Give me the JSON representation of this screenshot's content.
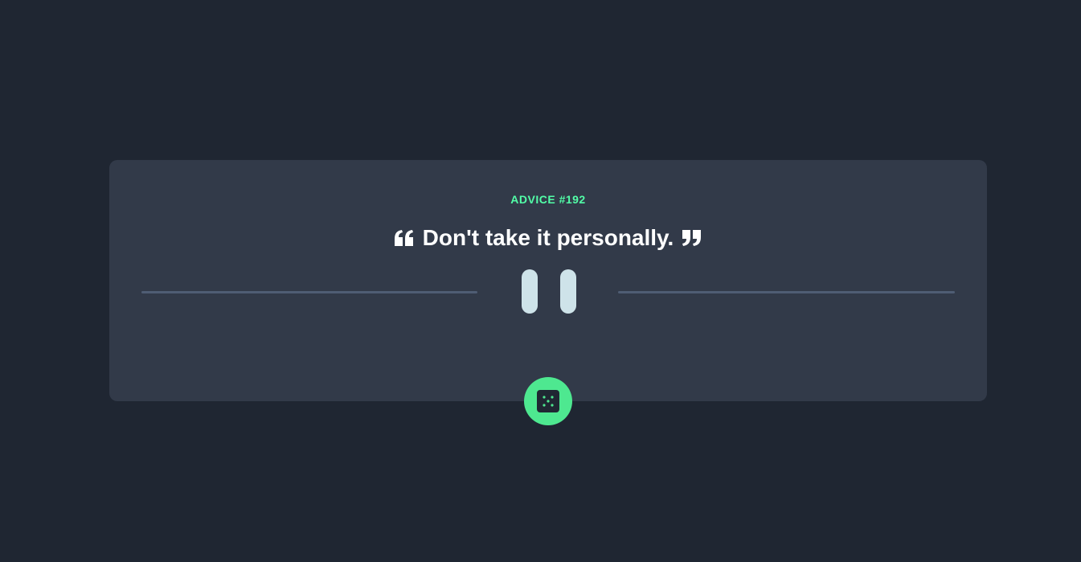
{
  "advice": {
    "id_label": "ADVICE #192",
    "text": "Don't take it personally."
  },
  "icons": {
    "open_quote": "open-quote-icon",
    "close_quote": "close-quote-icon",
    "divider": "pause-icon",
    "button": "dice-icon"
  },
  "colors": {
    "background": "#1f2632",
    "card": "#323a49",
    "accent": "#52ffa8",
    "text": "#ffffff",
    "divider": "#4f5d74",
    "pause": "#cee3e9"
  }
}
